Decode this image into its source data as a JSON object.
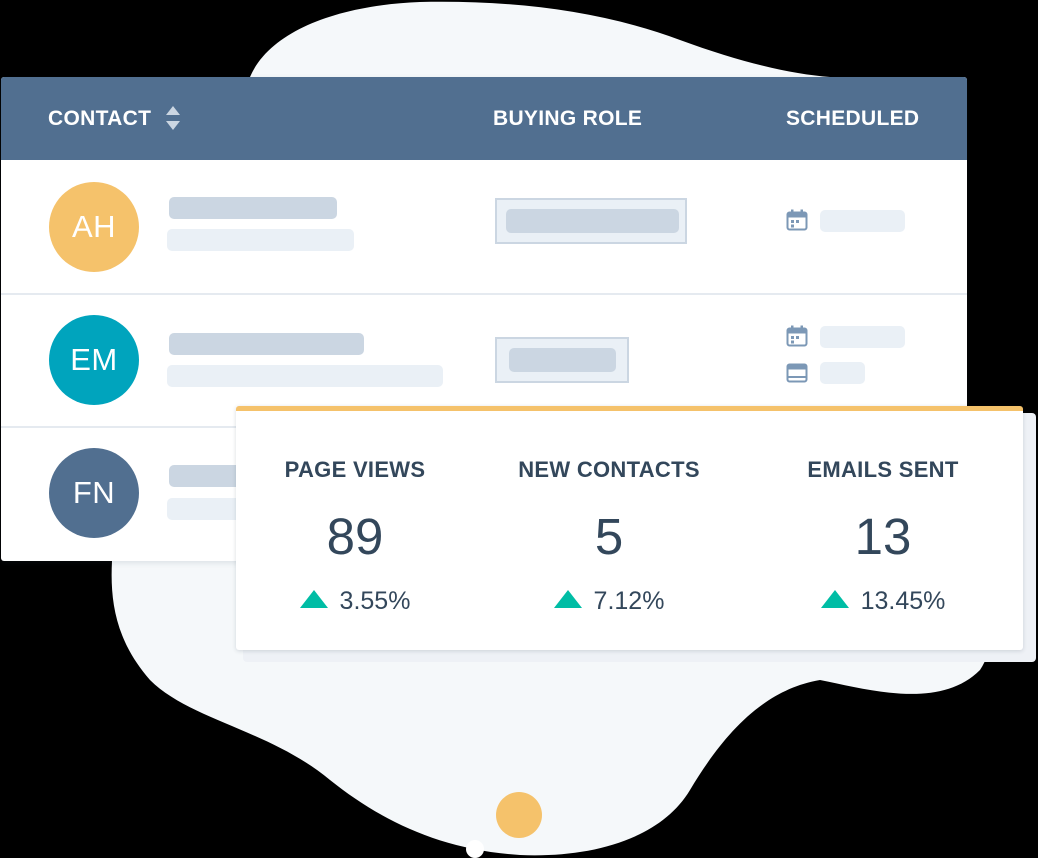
{
  "table": {
    "headers": {
      "contact": "CONTACT",
      "buying_role": "BUYING ROLE",
      "scheduled": "SCHEDULED"
    },
    "rows": [
      {
        "initials": "AH",
        "avatar_color": "#f5c26b"
      },
      {
        "initials": "EM",
        "avatar_color": "#00a4bd"
      },
      {
        "initials": "FN",
        "avatar_color": "#516f90"
      }
    ]
  },
  "stats": [
    {
      "label": "PAGE VIEWS",
      "value": "89",
      "change": "3.55%",
      "trend": "up"
    },
    {
      "label": "NEW CONTACTS",
      "value": "5",
      "change": "7.12%",
      "trend": "up"
    },
    {
      "label": "EMAILS SENT",
      "value": "13",
      "change": "13.45%",
      "trend": "up"
    }
  ],
  "colors": {
    "header_bg": "#516f90",
    "accent_yellow": "#f5c26b",
    "trend_up": "#00bda5",
    "text_dark": "#33475b",
    "placeholder_dark": "#cbd6e2",
    "placeholder_light": "#eaf0f6"
  },
  "icons": [
    "sort-icon",
    "calendar-icon",
    "meeting-icon"
  ]
}
